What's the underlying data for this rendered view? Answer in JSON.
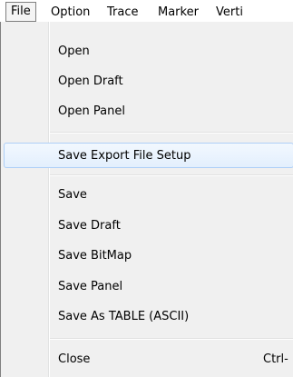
{
  "menubar": {
    "items": [
      {
        "label": "File"
      },
      {
        "label": "Option"
      },
      {
        "label": "Trace"
      },
      {
        "label": "Marker"
      },
      {
        "label": "Verti"
      }
    ]
  },
  "file_menu": {
    "items": [
      {
        "label": "Open"
      },
      {
        "label": "Open Draft"
      },
      {
        "label": "Open Panel"
      },
      {
        "label": "Save Export File Setup"
      },
      {
        "label": "Save"
      },
      {
        "label": "Save Draft"
      },
      {
        "label": "Save BitMap"
      },
      {
        "label": "Save Panel"
      },
      {
        "label": "Save As TABLE (ASCII)"
      },
      {
        "label": "Close",
        "shortcut": "Ctrl-"
      }
    ]
  }
}
